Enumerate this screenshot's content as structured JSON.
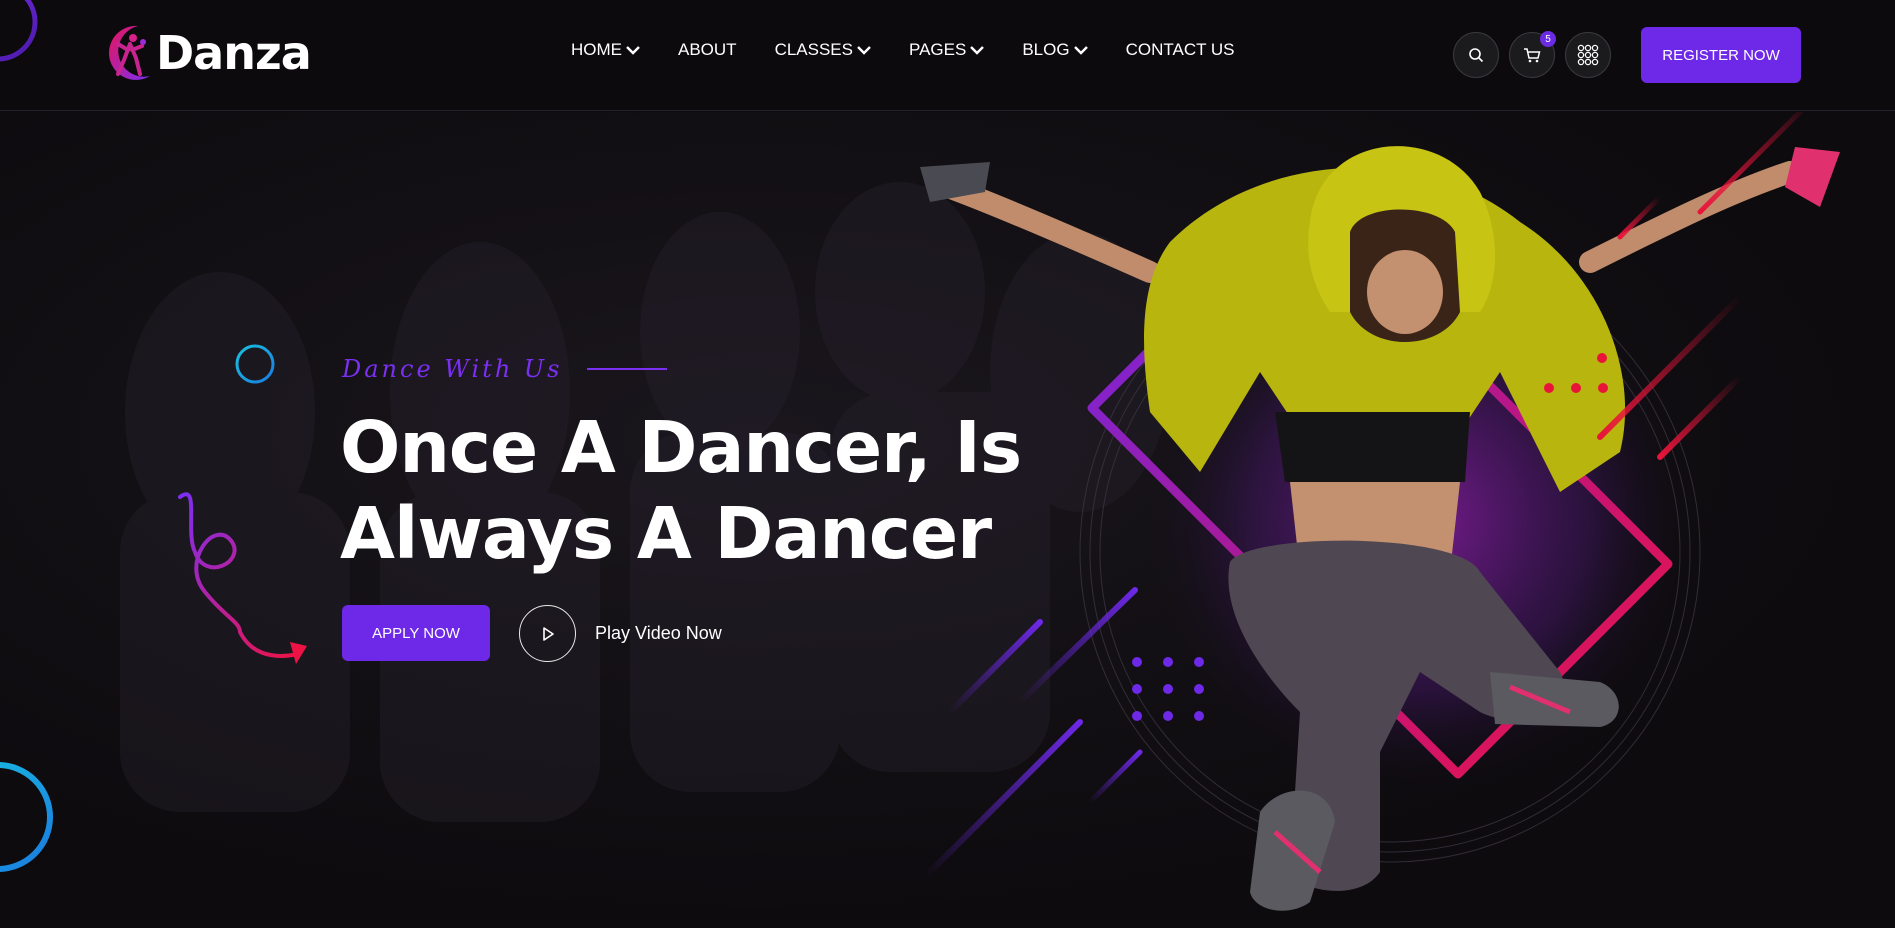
{
  "brand": {
    "name": "Danza"
  },
  "nav": {
    "items": [
      {
        "label": "HOME",
        "dropdown": true
      },
      {
        "label": "ABOUT",
        "dropdown": false
      },
      {
        "label": "CLASSES",
        "dropdown": true
      },
      {
        "label": "PAGES",
        "dropdown": true
      },
      {
        "label": "BLOG",
        "dropdown": true
      },
      {
        "label": "CONTACT US",
        "dropdown": false
      }
    ]
  },
  "header_actions": {
    "search_icon": "search-icon",
    "cart_icon": "cart-icon",
    "cart_count": "5",
    "menu_icon": "grid-menu-icon",
    "register_label": "REGISTER NOW"
  },
  "hero": {
    "subtitle": "Dance With Us",
    "headline_line1": "Once A Dancer, Is",
    "headline_line2": "Always A Dancer",
    "apply_label": "APPLY NOW",
    "play_label": "Play Video Now"
  },
  "colors": {
    "accent": "#6d28e8",
    "background": "#0d0b0e",
    "pink": "#e8145a",
    "cyan": "#19c2e0"
  }
}
